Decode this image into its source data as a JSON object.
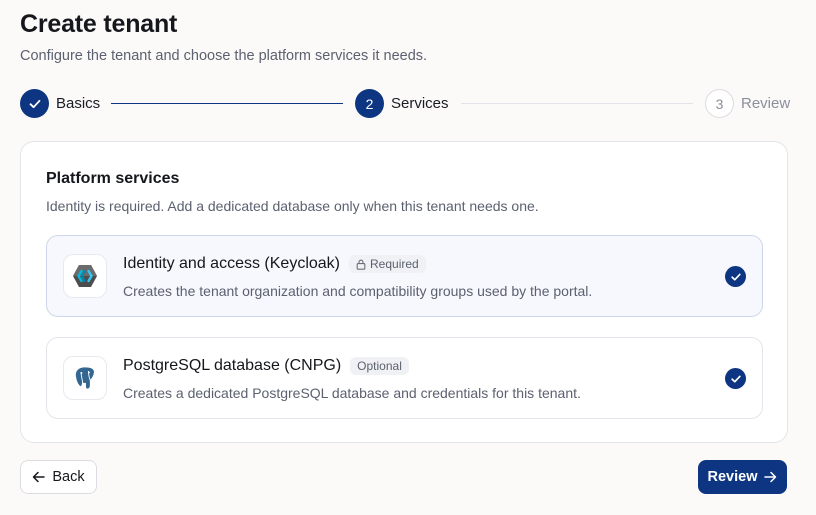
{
  "header": {
    "title": "Create tenant",
    "subtitle": "Configure the tenant and choose the platform services it needs."
  },
  "stepper": {
    "steps": [
      {
        "number": "1",
        "label": "Basics",
        "state": "done"
      },
      {
        "number": "2",
        "label": "Services",
        "state": "active"
      },
      {
        "number": "3",
        "label": "Review",
        "state": "todo"
      }
    ]
  },
  "services_card": {
    "title": "Platform services",
    "description": "Identity is required. Add a dedicated database only when this tenant needs one.",
    "items": [
      {
        "name": "Identity and access (Keycloak)",
        "badge": "Required",
        "badge_icon": "lock-icon",
        "description": "Creates the tenant organization and compatibility groups used by the portal.",
        "checked": true,
        "icon": "keycloak-icon"
      },
      {
        "name": "PostgreSQL database (CNPG)",
        "badge": "Optional",
        "description": "Creates a dedicated PostgreSQL database and credentials for this tenant.",
        "checked": true,
        "icon": "postgresql-icon"
      }
    ]
  },
  "footer": {
    "back_label": "Back",
    "review_label": "Review"
  },
  "colors": {
    "accent": "#0d3582",
    "background": "#fbfaf8",
    "muted_text": "#5c6170"
  }
}
